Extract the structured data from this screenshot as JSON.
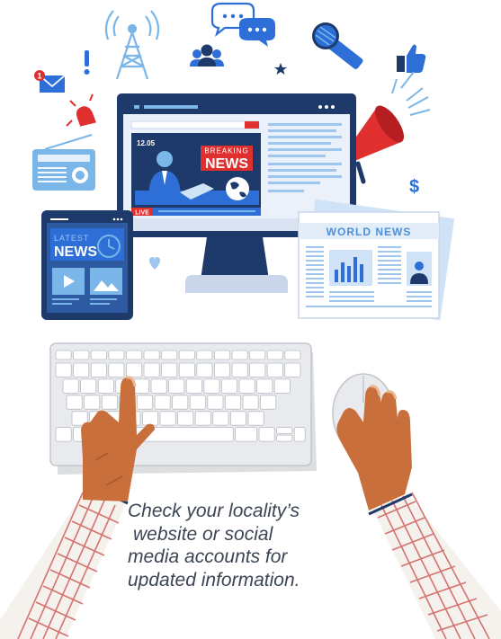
{
  "monitor": {
    "timestamp": "12.05",
    "breaking_label": "BREAKING",
    "news_label": "NEWS",
    "live_label": "LIVE"
  },
  "tablet": {
    "latest_label": "LATEST",
    "news_label": "NEWS"
  },
  "newspaper": {
    "masthead": "WORLD NEWS"
  },
  "caption": {
    "lines": [
      "Check your locality’s",
      "website or social",
      "media accounts for",
      "updated information."
    ]
  },
  "notification_count": "1",
  "icons": [
    "radio-tower-icon",
    "chat-bubbles-icon",
    "microphone-icon",
    "thumbs-up-icon",
    "people-icon",
    "envelope-icon",
    "exclamation-icon",
    "star-icon",
    "alarm-icon",
    "radio-icon",
    "megaphone-icon",
    "dollar-icon",
    "heart-icon"
  ],
  "colors": {
    "accent_blue": "#2d6fd6",
    "navy": "#1e3a6b",
    "light_blue": "#7ab6e8",
    "red": "#e02f2f",
    "skin": "#c96f3b",
    "shirt_check": "#c94a4a"
  }
}
